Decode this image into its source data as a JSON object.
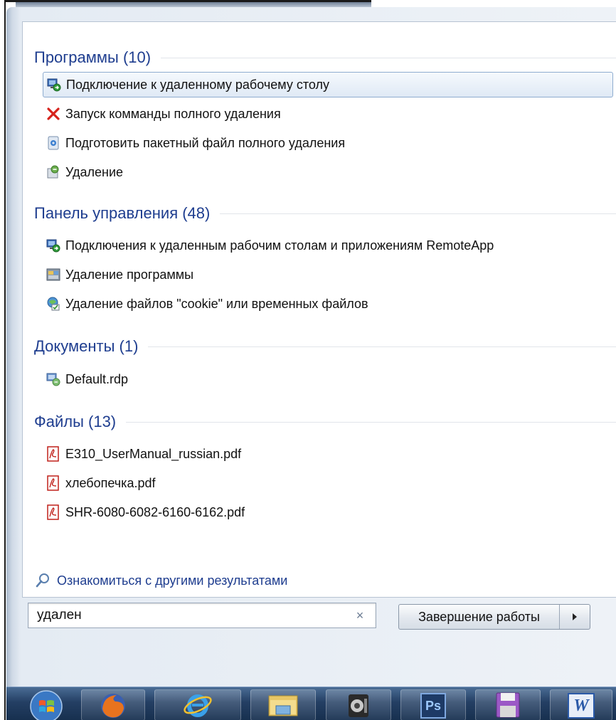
{
  "sections": [
    {
      "title": "Программы (10)",
      "items": [
        {
          "label": "Подключение к удаленному рабочему столу",
          "icon": "remote-desktop-icon"
        },
        {
          "label": "Запуск комманды полного удаления",
          "icon": "red-x-icon"
        },
        {
          "label": "Подготовить пакетный файл полного удаления",
          "icon": "batch-file-icon"
        },
        {
          "label": "Удаление",
          "icon": "uninstall-icon"
        }
      ]
    },
    {
      "title": "Панель управления (48)",
      "items": [
        {
          "label": "Подключения к удаленным рабочим столам и приложениям RemoteApp",
          "icon": "remote-desktop-icon"
        },
        {
          "label": "Удаление программы",
          "icon": "programs-icon"
        },
        {
          "label": "Удаление файлов \"cookie\" или временных файлов",
          "icon": "internet-options-icon"
        }
      ]
    },
    {
      "title": "Документы (1)",
      "items": [
        {
          "label": "Default.rdp",
          "icon": "rdp-file-icon"
        }
      ]
    },
    {
      "title": "Файлы (13)",
      "items": [
        {
          "label": "E310_UserManual_russian.pdf",
          "icon": "pdf-icon"
        },
        {
          "label": "хлебопечка.pdf",
          "icon": "pdf-icon"
        },
        {
          "label": "SHR-6080-6082-6160-6162.pdf",
          "icon": "pdf-icon"
        }
      ]
    }
  ],
  "more_results": {
    "label": "Ознакомиться с другими результатами",
    "icon": "magnifier-icon"
  },
  "search": {
    "value": "удален",
    "clear_icon": "×"
  },
  "shutdown": {
    "label": "Завершение работы",
    "arrow_icon": "arrow-right-icon"
  },
  "taskbar": {
    "items": [
      "windows-start-icon",
      "firefox-icon",
      "internet-explorer-icon",
      "file-explorer-icon",
      "media-speaker-icon",
      "photoshop-icon",
      "floppy-save-icon",
      "word-icon"
    ],
    "photoshop_label": "Ps",
    "word_label": "W"
  },
  "colors": {
    "heading": "#1e3d8f",
    "selection_border": "#8eaccf",
    "taskbar": "#243f64"
  }
}
